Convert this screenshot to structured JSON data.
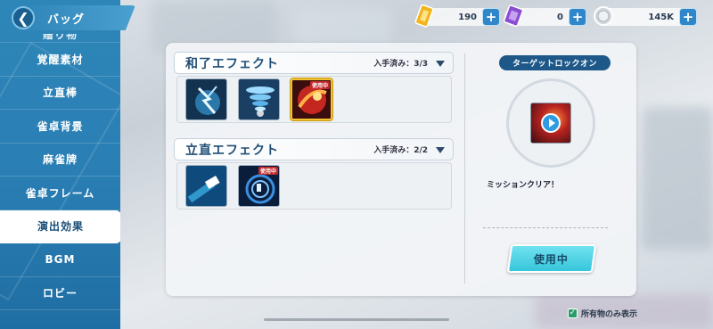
{
  "header": {
    "title": "バッグ",
    "back_icon": "chevron-left-icon"
  },
  "sidebar": {
    "items": [
      {
        "label": "贈り物",
        "partial": true
      },
      {
        "label": "覚醒素材"
      },
      {
        "label": "立直棒"
      },
      {
        "label": "雀卓背景"
      },
      {
        "label": "麻雀牌"
      },
      {
        "label": "雀卓フレーム"
      },
      {
        "label": "演出効果",
        "active": true
      },
      {
        "label": "BGM"
      },
      {
        "label": "ロビー"
      }
    ]
  },
  "currency": [
    {
      "icon": "gold-ticket-icon",
      "value": "190"
    },
    {
      "icon": "purple-ticket-icon",
      "value": "0"
    },
    {
      "icon": "coin-icon",
      "value": "145K"
    }
  ],
  "sections": [
    {
      "title": "和了エフェクト",
      "count": "入手済み：3/3",
      "items": [
        {
          "name": "lightning-effect",
          "badge": ""
        },
        {
          "name": "tornado-effect",
          "badge": ""
        },
        {
          "name": "flame-effect",
          "badge": "使用中",
          "selected": true
        }
      ]
    },
    {
      "title": "立直エフェクト",
      "count": "入手済み：2/2",
      "items": [
        {
          "name": "card-slide-effect",
          "badge": ""
        },
        {
          "name": "vortex-effect",
          "badge": "使用中"
        }
      ]
    }
  ],
  "preview": {
    "title": "ターゲットロックオン",
    "description": "ミッションクリア！",
    "button_label": "使用中"
  },
  "footer": {
    "owned_only_label": "所有物のみ表示",
    "owned_only_checked": true
  },
  "colors": {
    "accent": "#2a7fb4",
    "button": "#36c6da",
    "badge": "#c22a2a",
    "selected_border": "#f2c230"
  }
}
